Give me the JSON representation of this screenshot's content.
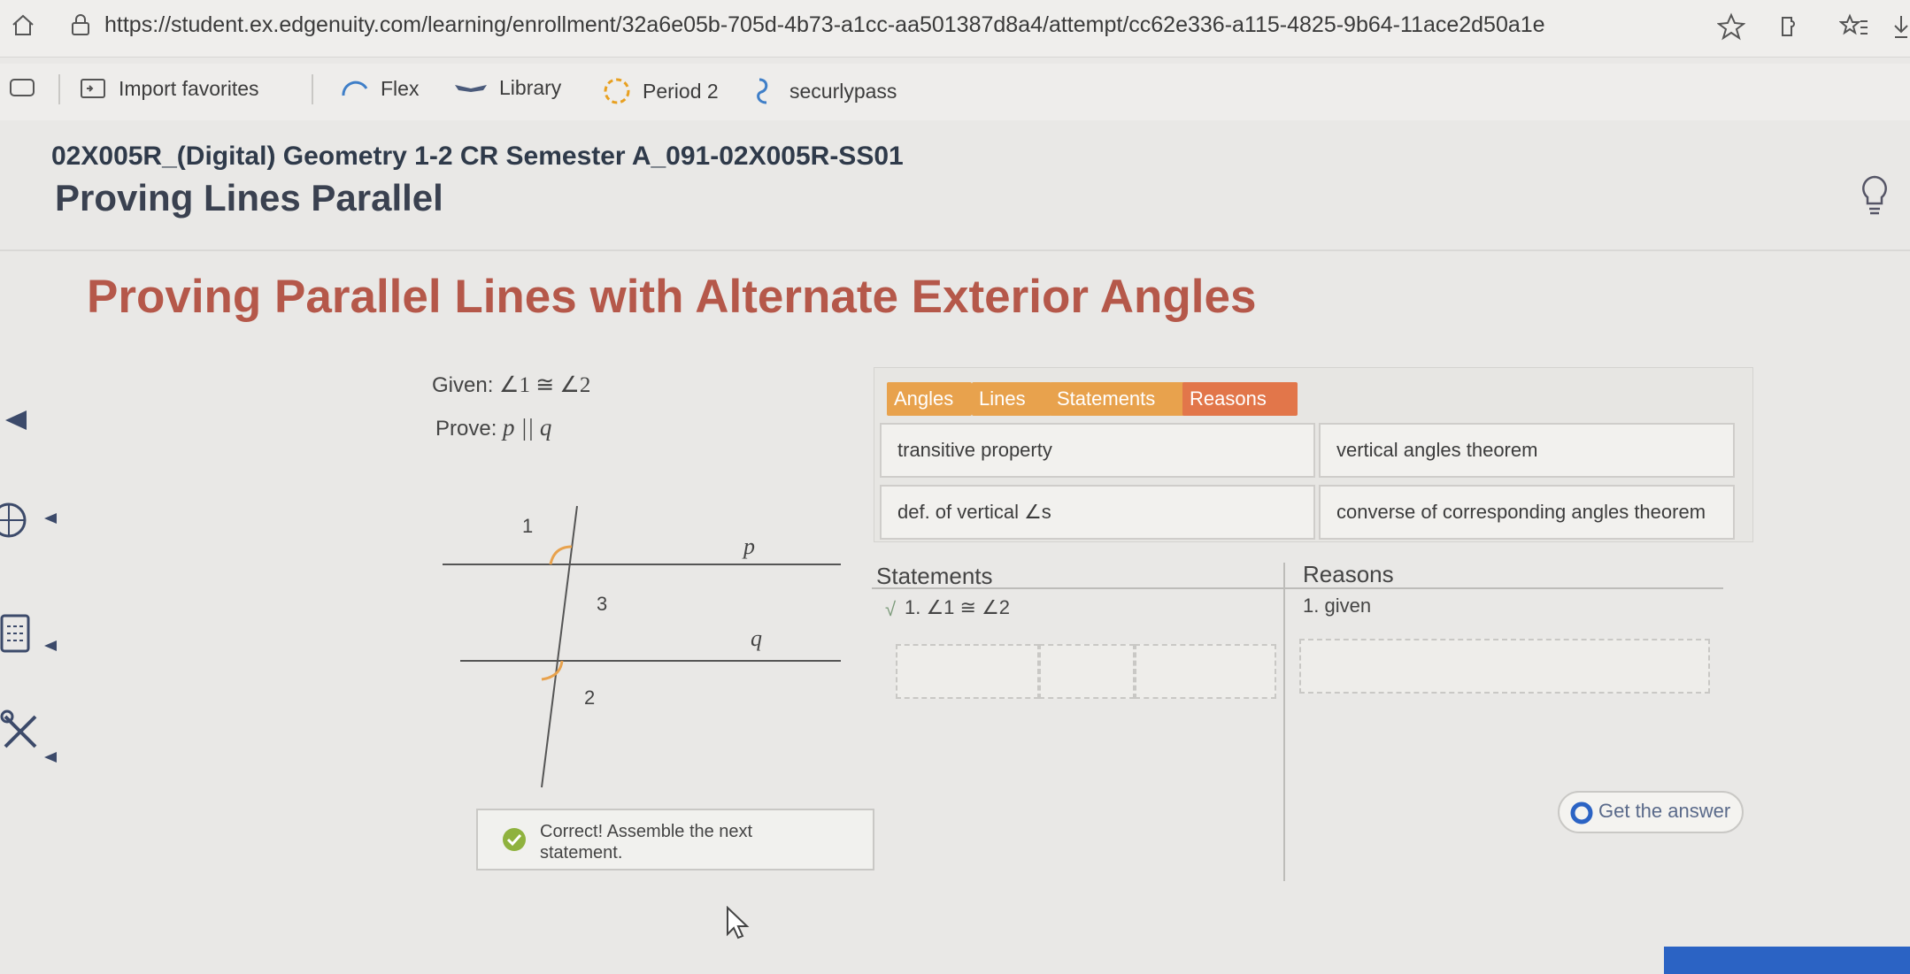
{
  "browser": {
    "url": "https://student.ex.edgenuity.com/learning/enrollment/32a6e05b-705d-4b73-a1cc-aa501387d8a4/attempt/cc62e336-a115-4825-9b64-11ace2d50a1e",
    "favorites": [
      {
        "label": "Import favorites",
        "icon": "import-icon"
      },
      {
        "label": "Flex",
        "icon": "flex-icon"
      },
      {
        "label": "Library",
        "icon": "library-icon"
      },
      {
        "label": "Period 2",
        "icon": "period-icon"
      },
      {
        "label": "securlypass",
        "icon": "securly-icon"
      }
    ]
  },
  "course": {
    "title": "02X005R_(Digital) Geometry 1-2 CR Semester A_091-02X005R-SS01",
    "lesson": "Proving Lines Parallel"
  },
  "activity": {
    "title": "Proving Parallel Lines with Alternate Exterior Angles",
    "given_label": "Given:",
    "given_value": "∠1 ≅ ∠2",
    "prove_label": "Prove:",
    "prove_value": "p || q",
    "diagram": {
      "labels": {
        "angle1": "1",
        "angle3": "3",
        "angle2": "2",
        "line_p": "p",
        "line_q": "q"
      }
    }
  },
  "tabs": [
    {
      "label": "Angles",
      "color": "#e8a24d"
    },
    {
      "label": "Lines",
      "color": "#e8a24d"
    },
    {
      "label": "Statements",
      "color": "#e8a24d"
    },
    {
      "label": "Reasons",
      "color": "#e2764a",
      "active": true
    }
  ],
  "reason_tiles": [
    "transitive property",
    "vertical angles theorem",
    "def. of vertical ∠s",
    "converse of corresponding angles theorem"
  ],
  "proof": {
    "statements_header": "Statements",
    "reasons_header": "Reasons",
    "rows": [
      {
        "check": "√",
        "statement": "1. ∠1 ≅ ∠2",
        "reason": "1. given"
      }
    ]
  },
  "feedback": {
    "message": "Correct! Assemble the next statement."
  },
  "get_answer_label": "Get the answer",
  "colors": {
    "title": "#b5584a",
    "tab": "#e8a24d",
    "tab_active": "#e2764a",
    "check": "#8fb23e"
  }
}
